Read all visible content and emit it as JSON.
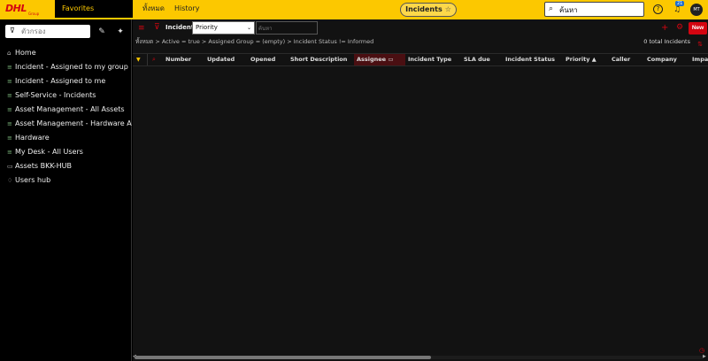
{
  "brand": {
    "logo_text": "DHL",
    "logo_sub": "Group"
  },
  "topnav": {
    "favorites": "Favorites",
    "all": "ทั้งหมด",
    "history": "History",
    "current_page": "Incidents",
    "search_value": "ค้นหา",
    "notification_count": "21",
    "avatar_initials": "MT"
  },
  "sidebar": {
    "filter_placeholder": "ตัวกรอง",
    "items": [
      {
        "label": "Home",
        "icon": "home-icon"
      },
      {
        "label": "Incident - Assigned to my group",
        "icon": "list-icon"
      },
      {
        "label": "Incident - Assigned to me",
        "icon": "list-icon"
      },
      {
        "label": "Self-Service - Incidents",
        "icon": "list-icon"
      },
      {
        "label": "Asset Management - All Assets",
        "icon": "list-icon"
      },
      {
        "label": "Asset Management - Hardware As...",
        "icon": "list-icon"
      },
      {
        "label": "Hardware",
        "icon": "list-icon"
      },
      {
        "label": "My Desk - All Users",
        "icon": "list-icon"
      },
      {
        "label": "Assets BKK-HUB",
        "icon": "dashboard-icon"
      },
      {
        "label": "Users hub",
        "icon": "bell-icon"
      }
    ]
  },
  "list": {
    "title": "Incidents",
    "field_select": "Priority",
    "search_placeholder": "ค้นหา",
    "breadcrumb": "ทั้งหมด > Active = true > Assigned Group = (empty) > Incident Status != Informed",
    "total": "0 total Incidents",
    "new_button": "New",
    "columns": [
      "Number",
      "Updated",
      "Opened",
      "Short Description",
      "Assignee",
      "Incident Type",
      "SLA due",
      "Incident Status",
      "Priority ▲",
      "Caller",
      "Company",
      "Impac"
    ]
  },
  "colors": {
    "accent_yellow": "#fcc800",
    "accent_red": "#d40511"
  }
}
